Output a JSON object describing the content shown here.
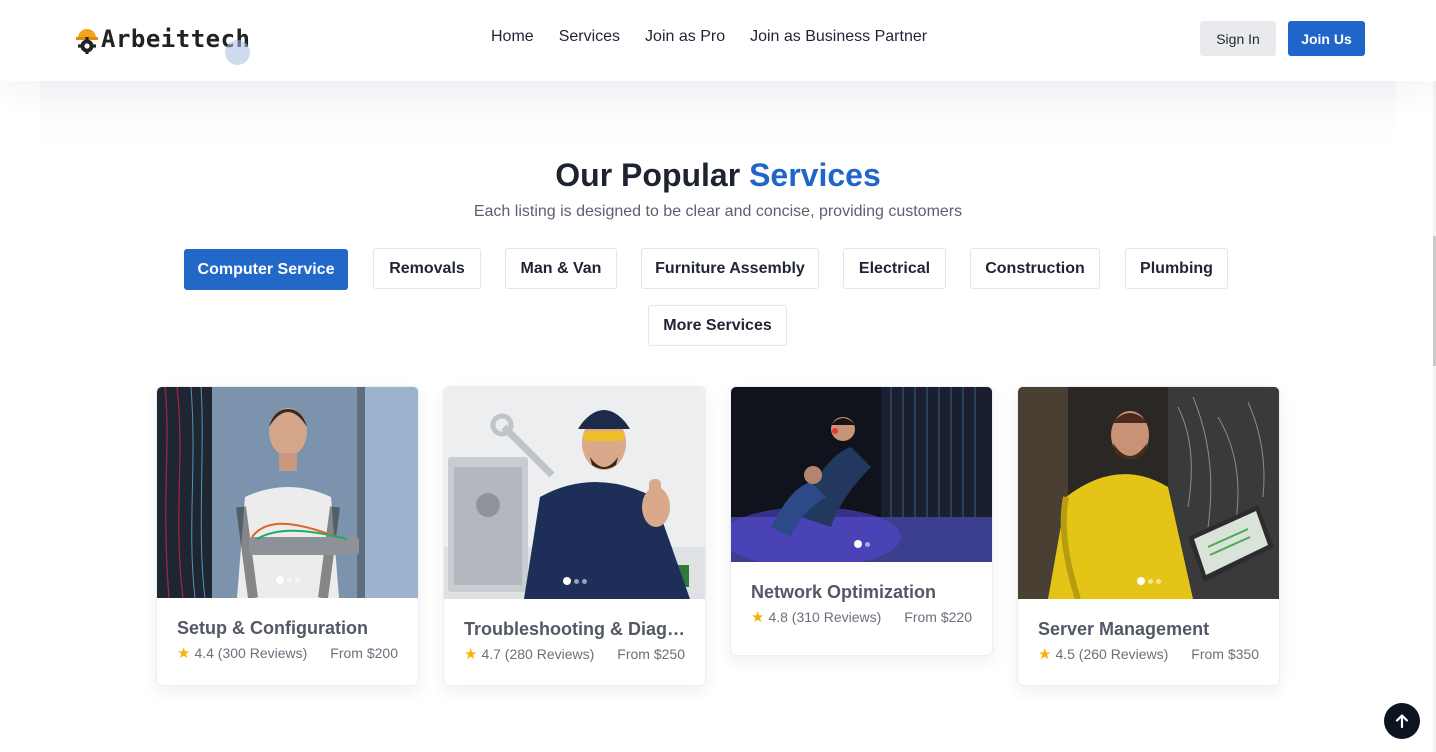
{
  "brand": {
    "name": "Arbeittech"
  },
  "nav": {
    "items": [
      "Home",
      "Services",
      "Join as Pro",
      "Join as Business Partner"
    ],
    "sign_in": "Sign In",
    "join_us": "Join Us"
  },
  "section": {
    "title_main": "Our Popular",
    "title_accent": "Services",
    "subtitle": "Each listing is designed to be clear and concise, providing customers"
  },
  "tabs": [
    "Computer Service",
    "Removals",
    "Man & Van",
    "Furniture Assembly",
    "Electrical",
    "Construction",
    "Plumbing",
    "More Services"
  ],
  "active_tab": "Computer Service",
  "cards": [
    {
      "title": "Setup & Configuration",
      "rating": "4.4 (300 Reviews)",
      "price": "From $200"
    },
    {
      "title": "Troubleshooting & Diagnostics",
      "rating": "4.7 (280 Reviews)",
      "price": "From $250"
    },
    {
      "title": "Network Optimization",
      "rating": "4.8 (310 Reviews)",
      "price": "From $220"
    },
    {
      "title": "Server Management",
      "rating": "4.5 (260 Reviews)",
      "price": "From $350"
    }
  ],
  "icons": {
    "logo": "gear-hardhat-icon",
    "star": "star-icon",
    "back_to_top": "arrow-up-icon"
  },
  "colors": {
    "accent": "#2066c9",
    "star": "#f6b400",
    "dark": "#0d1320"
  }
}
